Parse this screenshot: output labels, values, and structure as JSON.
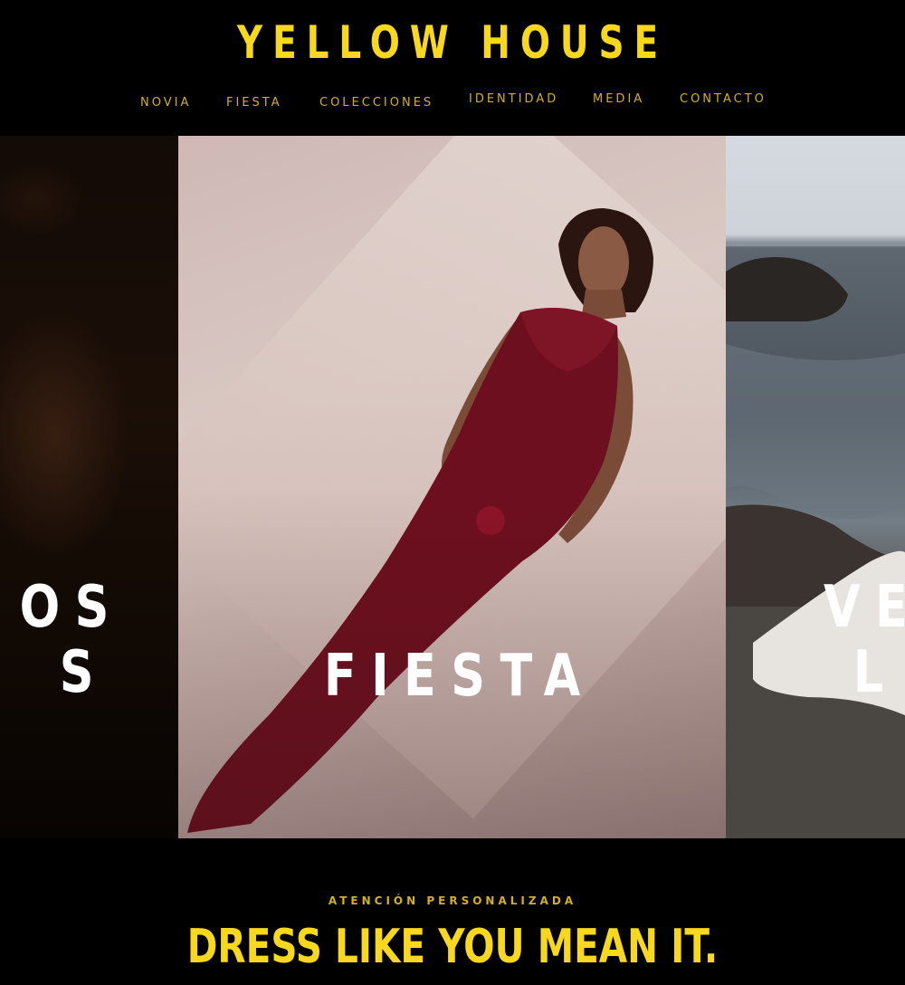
{
  "header": {
    "logo": "YELLOW HOUSE",
    "nav": [
      "NOVIA",
      "FIESTA",
      "COLECCIONES",
      "IDENTIDAD",
      "MEDIA",
      "CONTACTO"
    ]
  },
  "slider": {
    "left_panel": {
      "title_line1": "OS",
      "title_line2": "S"
    },
    "center_panel": {
      "title": "FIESTA"
    },
    "right_panel": {
      "title_line1": "VE",
      "title_line2": "L"
    }
  },
  "tagline": {
    "eyebrow": "ATENCIÓN PERSONALIZADA",
    "headline": "DRESS LIKE YOU MEAN IT."
  },
  "colors": {
    "brand_yellow": "#f7d81c",
    "nav_gold": "#d4b11c",
    "background": "#000000"
  }
}
